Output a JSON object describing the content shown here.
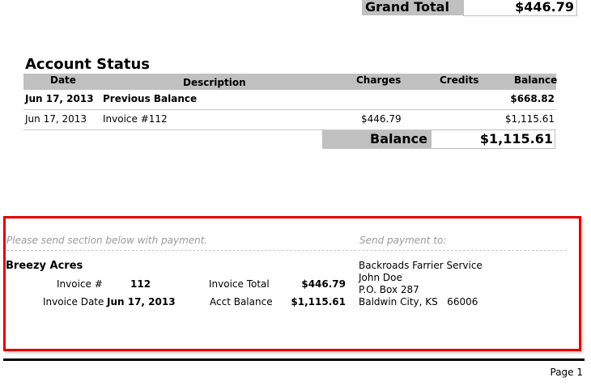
{
  "grand_total": {
    "label": "Grand Total",
    "value": "$446.79"
  },
  "account_status": {
    "title": "Account Status",
    "columns": [
      "Date",
      "Description",
      "Charges",
      "Credits",
      "Balance"
    ],
    "rows": [
      {
        "date": "Jun 17, 2013",
        "description": "Previous Balance",
        "charges": "",
        "credits": "",
        "balance": "$668.82",
        "bold": true
      },
      {
        "date": "Jun 17, 2013",
        "description": "Invoice #112",
        "charges": "$446.79",
        "credits": "",
        "balance": "$1,115.61",
        "bold": false
      }
    ],
    "balance_label": "Balance",
    "balance_value": "$1,115.61"
  },
  "stub": {
    "send_section_hint": "Please send section below with payment.",
    "send_to_hint": "Send payment to:",
    "customer": "Breezy Acres",
    "invoice_no_label": "Invoice #",
    "invoice_no": "112",
    "invoice_date_label": "Invoice Date",
    "invoice_date": "Jun 17, 2013",
    "invoice_total_label": "Invoice Total",
    "invoice_total": "$446.79",
    "acct_balance_label": "Acct Balance",
    "acct_balance": "$1,115.61",
    "remit": {
      "company": "Backroads Farrier Service",
      "name": "John Doe",
      "address": "P.O. Box 287",
      "city": "Baldwin City, KS   66006"
    },
    "highlight_color": "#e00000"
  },
  "footer": {
    "page": "Page 1"
  }
}
